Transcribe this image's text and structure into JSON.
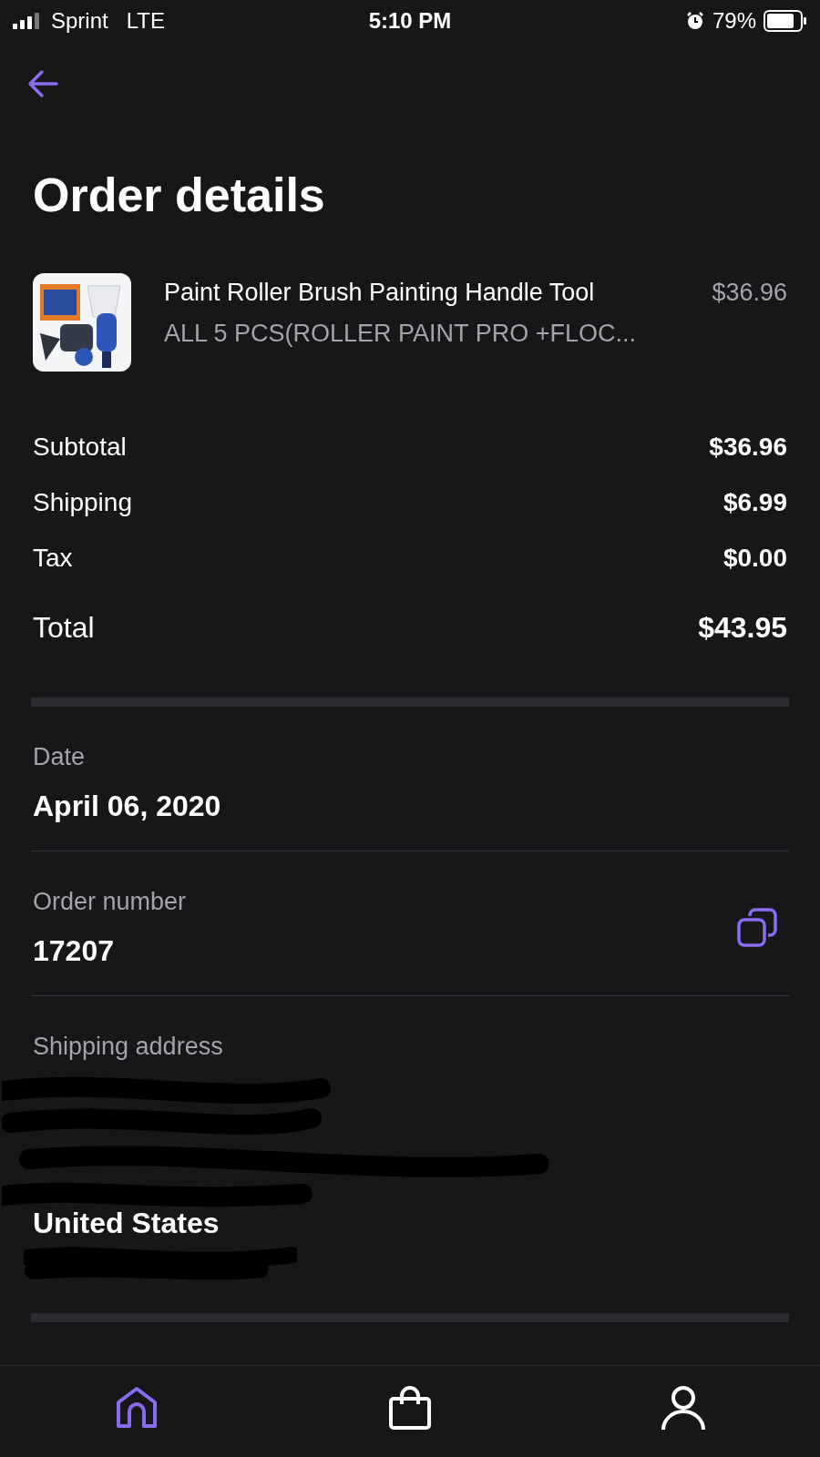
{
  "status_bar": {
    "carrier": "Sprint",
    "network": "LTE",
    "time": "5:10 PM",
    "battery": "79%"
  },
  "title": "Order details",
  "product": {
    "kind": "picture",
    "name": "Paint Roller Brush Painting Handle Tool",
    "variant": "ALL 5 PCS(ROLLER PAINT PRO +FLOC...",
    "price": "$36.96"
  },
  "summary": [
    {
      "label": "Subtotal",
      "value": "$36.96",
      "kind": "line"
    },
    {
      "label": "Shipping",
      "value": "$6.99",
      "kind": "line"
    },
    {
      "label": "Tax",
      "value": "$0.00",
      "kind": "line"
    },
    {
      "label": "Total",
      "value": "$43.95",
      "kind": "total"
    }
  ],
  "details": [
    {
      "label": "Date",
      "value": "April 06, 2020",
      "copyable": false
    },
    {
      "label": "Order number",
      "value": "17207",
      "copyable": true
    }
  ],
  "shipping_address": {
    "label": "Shipping address",
    "lines": [
      "United States"
    ]
  },
  "nav": [
    {
      "kind": "home",
      "selected": true
    },
    {
      "kind": "bag",
      "selected": false
    },
    {
      "kind": "profile",
      "selected": false
    }
  ]
}
